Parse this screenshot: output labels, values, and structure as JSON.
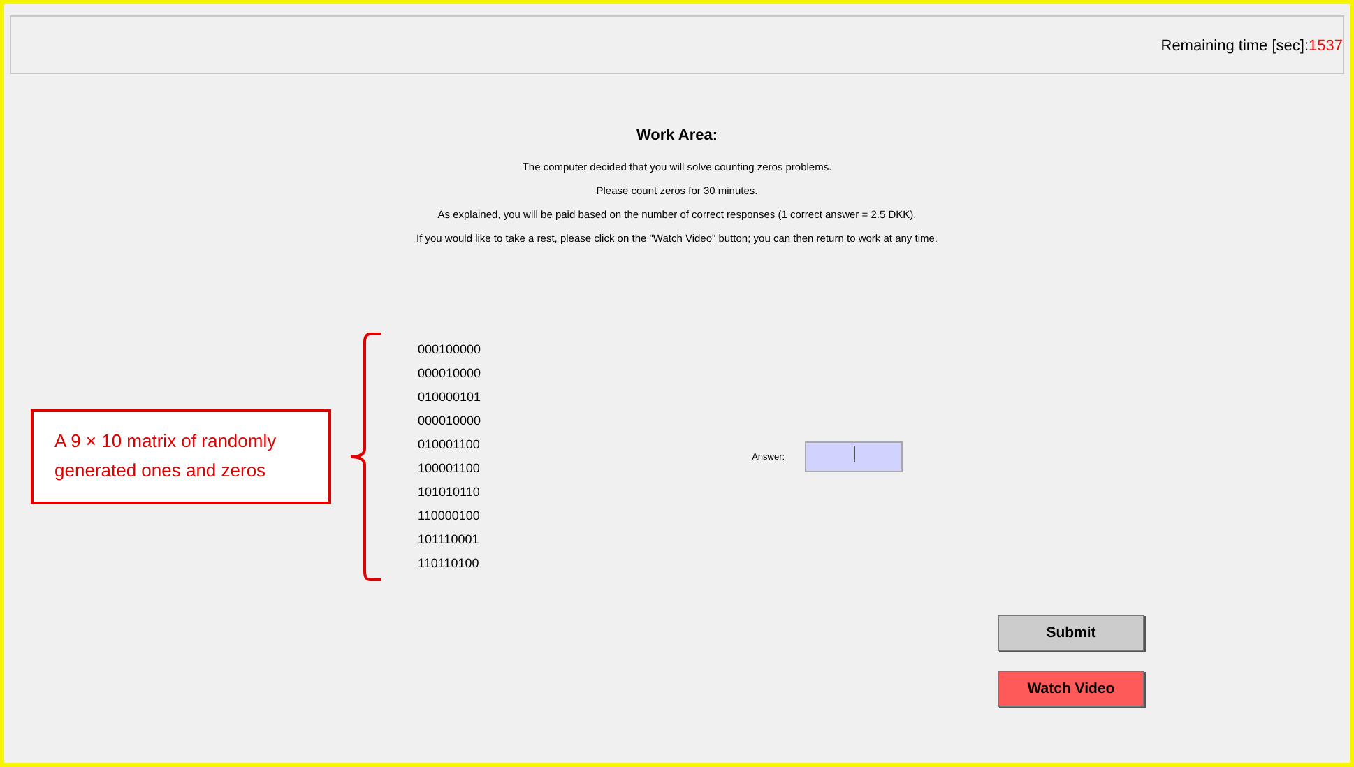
{
  "header": {
    "timer_label": "Remaining time [sec]:",
    "timer_value": "1537"
  },
  "work_area": {
    "title": "Work Area:",
    "lines": [
      "The computer decided that you will solve counting zeros problems.",
      "Please count zeros for 30 minutes.",
      "As explained, you will be paid based on the number of correct responses (1 correct answer = 2.5 DKK).",
      "If you would like to take a rest, please click on the \"Watch Video\" button; you can then return to work at any time."
    ]
  },
  "annotation": {
    "text": "A 9 × 10 matrix of randomly generated ones and zeros"
  },
  "matrix": [
    "000100000",
    "000010000",
    "010000101",
    "000010000",
    "010001100",
    "100001100",
    "101010110",
    "110000100",
    "101110001",
    "110110100"
  ],
  "answer": {
    "label": "Answer:"
  },
  "buttons": [
    {
      "kind": "submit",
      "label": "Submit"
    },
    {
      "kind": "video",
      "label": "Watch Video"
    }
  ]
}
